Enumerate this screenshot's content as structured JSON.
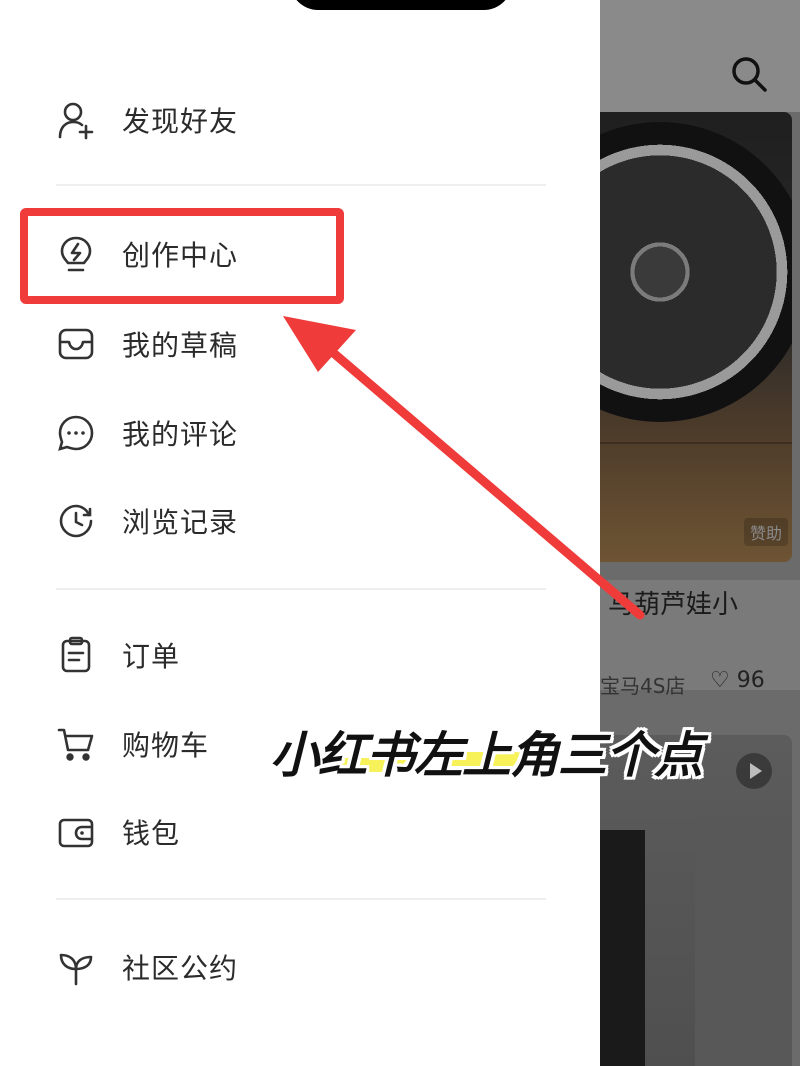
{
  "drawer": {
    "items": [
      {
        "label": "发现好友",
        "icon": "add-friend-icon"
      },
      {
        "label": "创作中心",
        "icon": "lightbulb-icon"
      },
      {
        "label": "我的草稿",
        "icon": "inbox-tray-icon"
      },
      {
        "label": "我的评论",
        "icon": "chat-bubble-icon"
      },
      {
        "label": "浏览记录",
        "icon": "history-clock-icon"
      },
      {
        "label": "订单",
        "icon": "order-clipboard-icon"
      },
      {
        "label": "购物车",
        "icon": "shopping-cart-icon"
      },
      {
        "label": "钱包",
        "icon": "wallet-icon"
      },
      {
        "label": "社区公约",
        "icon": "sprout-icon"
      }
    ]
  },
  "background": {
    "search_icon": "search-icon",
    "sponsor_badge": "赞助",
    "card_title": "马葫芦娃小",
    "card_meta": "宝马4S店",
    "likes": "96",
    "play_icon": "play-icon"
  },
  "annotation": {
    "caption": "小红书左上角三个点",
    "highlight_color": "#ef3b39",
    "caption_highlight_color": "#f6f03c"
  }
}
